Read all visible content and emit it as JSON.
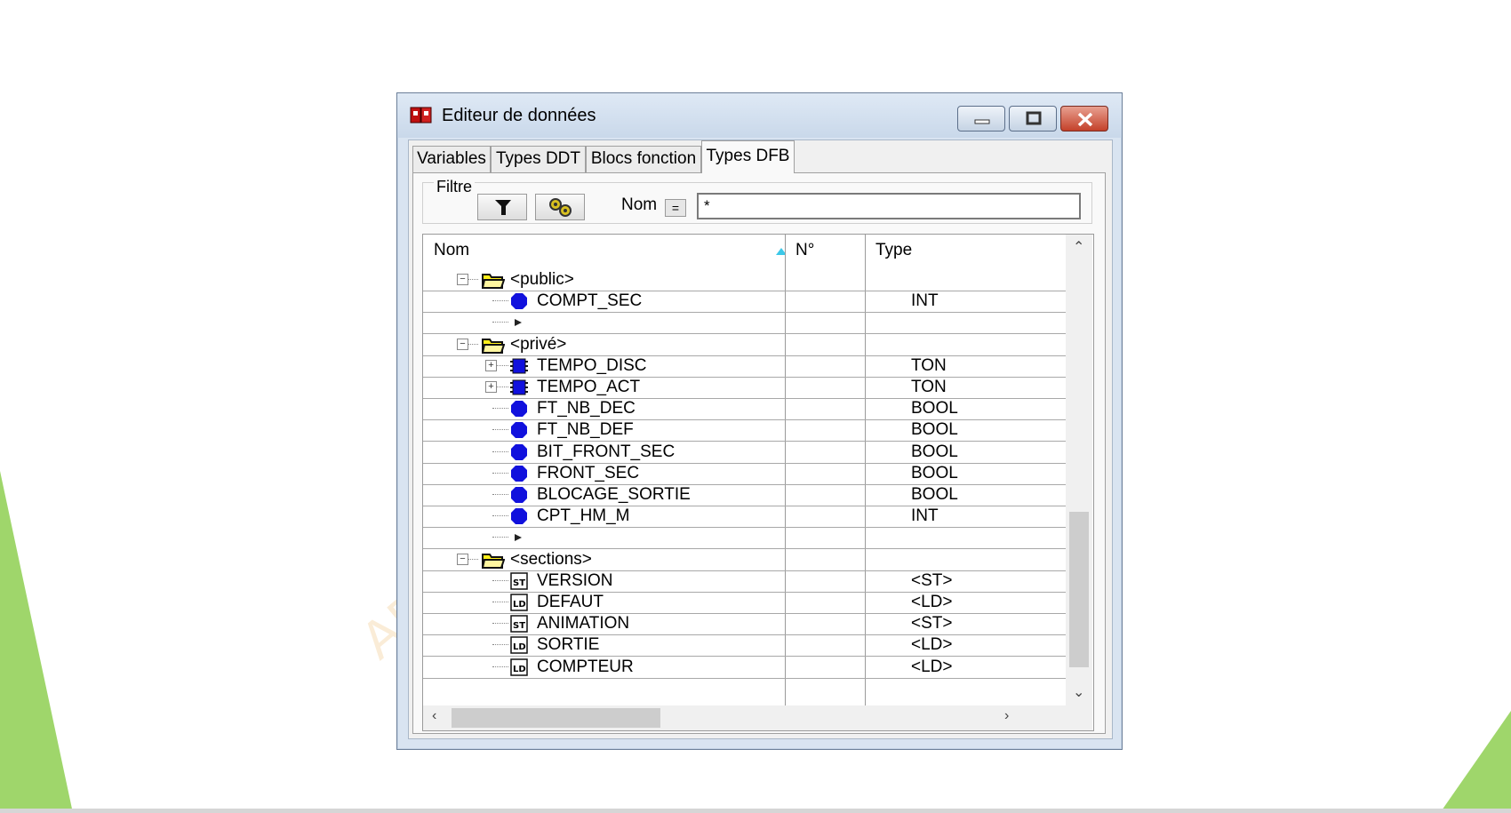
{
  "colors": {
    "accent_green": "#9fd66b",
    "folder_yellow": "#ffef1a",
    "var_blue": "#1111dd"
  },
  "window": {
    "title": "Editeur de données",
    "icon": "dfb-editor-icon"
  },
  "tabs": [
    {
      "label": "Variables",
      "active": false
    },
    {
      "label": "Types DDT",
      "active": false
    },
    {
      "label": "Blocs fonction",
      "active": false
    },
    {
      "label": "Types DFB",
      "active": true
    }
  ],
  "filter": {
    "label": "Filtre",
    "nom_label": "Nom",
    "eq_label": "=",
    "value": "*"
  },
  "grid": {
    "headers": {
      "name": "Nom",
      "number": "N°",
      "type": "Type"
    },
    "rows": [
      {
        "kind": "folder",
        "name": "<public>",
        "type": ""
      },
      {
        "kind": "var",
        "name": "COMPT_SEC",
        "type": "INT"
      },
      {
        "kind": "new",
        "name": "",
        "type": ""
      },
      {
        "kind": "folder",
        "name": "<privé>",
        "type": ""
      },
      {
        "kind": "fb",
        "name": "TEMPO_DISC",
        "type": "TON"
      },
      {
        "kind": "fb",
        "name": "TEMPO_ACT",
        "type": "TON"
      },
      {
        "kind": "var",
        "name": "FT_NB_DEC",
        "type": "BOOL"
      },
      {
        "kind": "var",
        "name": "FT_NB_DEF",
        "type": "BOOL"
      },
      {
        "kind": "var",
        "name": "BIT_FRONT_SEC",
        "type": "BOOL"
      },
      {
        "kind": "var",
        "name": "FRONT_SEC",
        "type": "BOOL"
      },
      {
        "kind": "var",
        "name": "BLOCAGE_SORTIE",
        "type": "BOOL"
      },
      {
        "kind": "var",
        "name": "CPT_HM_M",
        "type": "INT"
      },
      {
        "kind": "new",
        "name": "",
        "type": ""
      },
      {
        "kind": "folder",
        "name": "<sections>",
        "type": ""
      },
      {
        "kind": "st",
        "name": "VERSION",
        "type": "<ST>"
      },
      {
        "kind": "ld",
        "name": "DEFAUT",
        "type": "<LD>"
      },
      {
        "kind": "st",
        "name": "ANIMATION",
        "type": "<ST>"
      },
      {
        "kind": "ld",
        "name": "SORTIE",
        "type": "<LD>"
      },
      {
        "kind": "ld",
        "name": "COMPTEUR",
        "type": "<LD>"
      }
    ]
  },
  "watermark": "AP"
}
